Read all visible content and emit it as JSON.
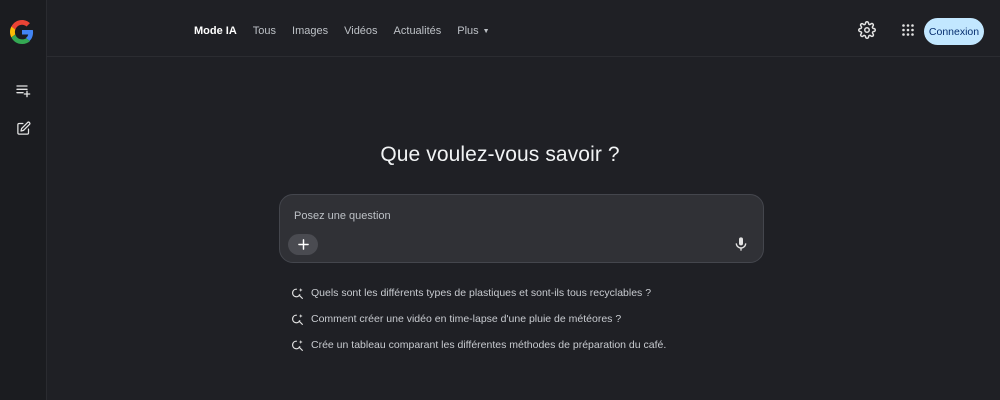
{
  "sidebar": {
    "logo_icon": "google-g-logo",
    "items": [
      {
        "icon": "history-list-icon"
      },
      {
        "icon": "new-chat-edit-icon"
      }
    ]
  },
  "nav": {
    "tabs": [
      {
        "label": "Mode IA",
        "active": true
      },
      {
        "label": "Tous"
      },
      {
        "label": "Images"
      },
      {
        "label": "Vidéos"
      },
      {
        "label": "Actualités"
      },
      {
        "label": "Plus"
      }
    ]
  },
  "header": {
    "signin_label": "Connexion",
    "settings_icon": "gear-icon",
    "apps_icon": "apps-grid-icon"
  },
  "main": {
    "headline": "Que voulez-vous savoir ?",
    "search": {
      "placeholder": "Posez une question",
      "value": ""
    },
    "suggestions": [
      "Quels sont les différents types de plastiques et sont-ils tous recyclables ?",
      "Comment créer une vidéo en time-lapse d'une pluie de météores ?",
      "Crée un tableau comparant les différentes méthodes de préparation du café."
    ]
  },
  "colors": {
    "background": "#1f2025",
    "signin_button": "#c2e7ff",
    "searchbox": "#303136"
  }
}
